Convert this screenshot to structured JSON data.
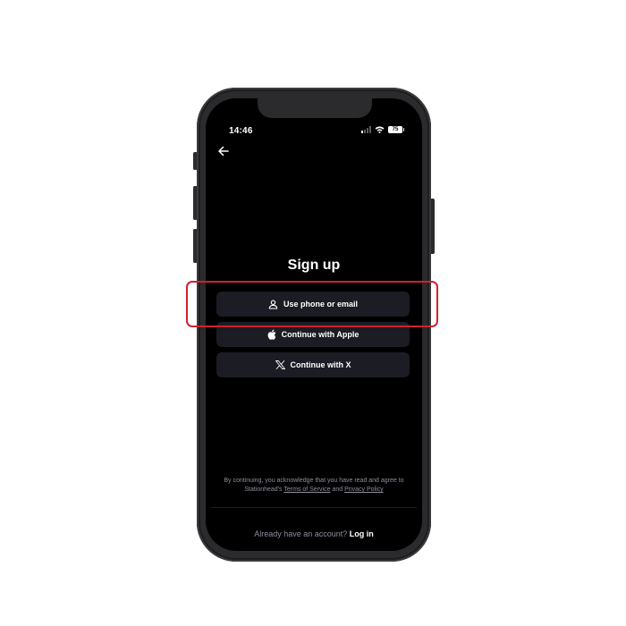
{
  "status_bar": {
    "time": "14:46",
    "battery": "75"
  },
  "screen": {
    "title": "Sign up",
    "buttons": [
      {
        "label": "Use phone or email",
        "icon": "person-icon"
      },
      {
        "label": "Continue with Apple",
        "icon": "apple-icon"
      },
      {
        "label": "Continue with X",
        "icon": "x-logo-icon"
      }
    ],
    "legal": {
      "prefix": "By continuing, you acknowledge that you have read and agree to Stationhead's",
      "terms": "Terms of Service",
      "and": "and",
      "privacy": "Privacy Policy"
    },
    "login_prompt": "Already have an account?",
    "login_link": "Log in"
  },
  "highlight": {
    "color": "#d0212f",
    "target": "use-phone-or-email-button"
  },
  "colors": {
    "background": "#000000",
    "button_bg": "#1c1c24",
    "text_muted": "#8e8ea0"
  }
}
